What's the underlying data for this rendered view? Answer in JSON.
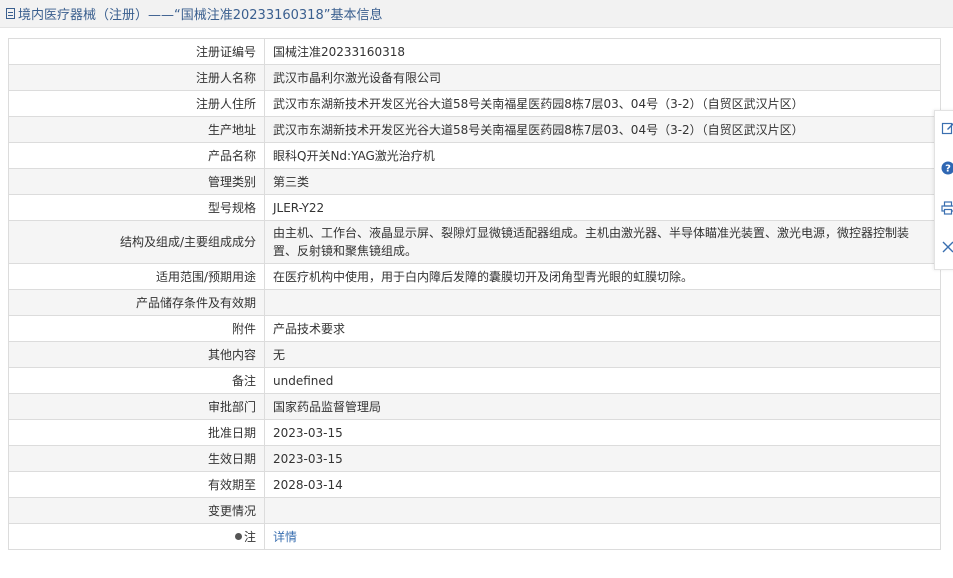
{
  "header": {
    "title": "境内医疗器械（注册）——“国械注准20233160318”基本信息"
  },
  "rows": [
    {
      "label": "注册证编号",
      "value": "国械注准20233160318"
    },
    {
      "label": "注册人名称",
      "value": "武汉市晶利尔激光设备有限公司"
    },
    {
      "label": "注册人住所",
      "value": "武汉市东湖新技术开发区光谷大道58号关南福星医药园8栋7层03、04号（3-2）（自贸区武汉片区）"
    },
    {
      "label": "生产地址",
      "value": "武汉市东湖新技术开发区光谷大道58号关南福星医药园8栋7层03、04号（3-2）（自贸区武汉片区）"
    },
    {
      "label": "产品名称",
      "value": "眼科Q开关Nd:YAG激光治疗机"
    },
    {
      "label": "管理类别",
      "value": "第三类"
    },
    {
      "label": "型号规格",
      "value": "JLER-Y22"
    },
    {
      "label": "结构及组成/主要组成成分",
      "value": "由主机、工作台、液晶显示屏、裂隙灯显微镜适配器组成。主机由激光器、半导体瞄准光装置、激光电源，微控器控制装置、反射镜和聚焦镜组成。"
    },
    {
      "label": "适用范围/预期用途",
      "value": "在医疗机构中使用，用于白内障后发障的囊膜切开及闭角型青光眼的虹膜切除。"
    },
    {
      "label": "产品储存条件及有效期",
      "value": ""
    },
    {
      "label": "附件",
      "value": "产品技术要求"
    },
    {
      "label": "其他内容",
      "value": "无"
    },
    {
      "label": "备注",
      "value": "undefined"
    },
    {
      "label": "审批部门",
      "value": "国家药品监督管理局"
    },
    {
      "label": "批准日期",
      "value": "2023-03-15"
    },
    {
      "label": "生效日期",
      "value": "2023-03-15"
    },
    {
      "label": "有效期至",
      "value": "2028-03-14"
    },
    {
      "label": "变更情况",
      "value": ""
    }
  ],
  "note": {
    "label": "注",
    "link_text": "详情"
  },
  "tools": [
    "edit-icon",
    "help-icon",
    "print-icon",
    "close-icon"
  ]
}
